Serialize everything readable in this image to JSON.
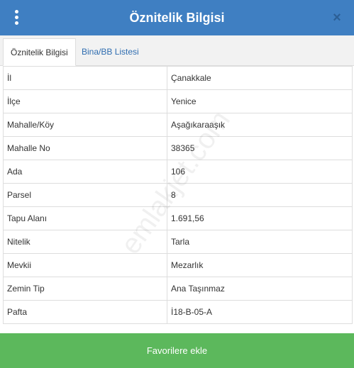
{
  "header": {
    "title": "Öznitelik Bilgisi",
    "close_label": "×"
  },
  "tabs": [
    {
      "label": "Öznitelik Bilgisi",
      "active": true
    },
    {
      "label": "Bina/BB Listesi",
      "active": false
    }
  ],
  "rows": [
    {
      "key": "İl",
      "value": "Çanakkale"
    },
    {
      "key": "İlçe",
      "value": "Yenice"
    },
    {
      "key": "Mahalle/Köy",
      "value": "Aşağıkaraaşık"
    },
    {
      "key": "Mahalle No",
      "value": "38365"
    },
    {
      "key": "Ada",
      "value": "106"
    },
    {
      "key": "Parsel",
      "value": "8"
    },
    {
      "key": "Tapu Alanı",
      "value": "1.691,56"
    },
    {
      "key": "Nitelik",
      "value": "Tarla"
    },
    {
      "key": "Mevkii",
      "value": "Mezarlık"
    },
    {
      "key": "Zemin Tip",
      "value": "Ana Taşınmaz"
    },
    {
      "key": "Pafta",
      "value": "İ18-B-05-A"
    }
  ],
  "watermark": "emlakjet.com",
  "footer": {
    "button_label": "Favorilere ekle"
  },
  "colors": {
    "header_bg": "#3f7fc2",
    "button_bg": "#5cb85c",
    "tab_link": "#2f6db0"
  },
  "icons": [
    "menu-dots-icon",
    "close-icon"
  ]
}
